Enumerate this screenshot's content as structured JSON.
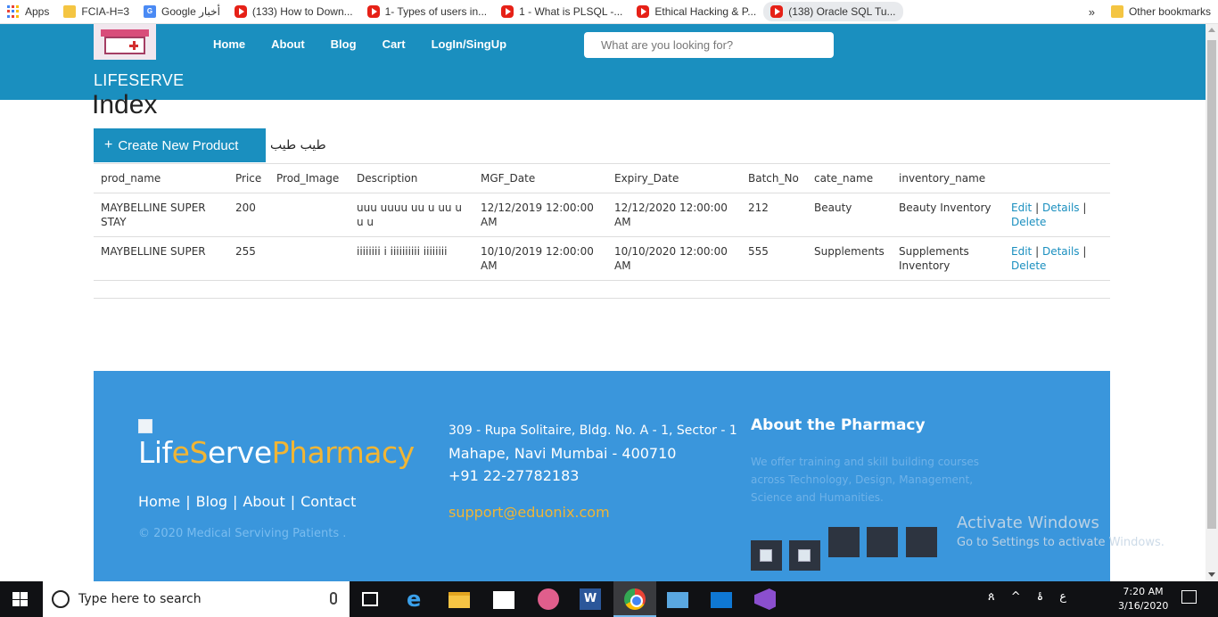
{
  "bookmarks": [
    {
      "label": "Apps",
      "icon": "apps-grid-icon"
    },
    {
      "label": "FCIA-H=3",
      "icon": "folder-icon"
    },
    {
      "label": "Google أخبار",
      "icon": "google-news-icon"
    },
    {
      "label": "(133) How to Down...",
      "icon": "youtube-icon"
    },
    {
      "label": "1- Types of users in...",
      "icon": "youtube-icon"
    },
    {
      "label": "1 - What is PLSQL -...",
      "icon": "youtube-icon"
    },
    {
      "label": "Ethical Hacking & P...",
      "icon": "youtube-icon"
    },
    {
      "label": "(138) Oracle SQL Tu...",
      "icon": "youtube-icon"
    }
  ],
  "bookmarks_more": "»",
  "bookmarks_other": "Other bookmarks",
  "header": {
    "brand": "LIFESERVE",
    "nav": [
      "Home",
      "About",
      "Blog",
      "Cart",
      "LogIn/SingUp"
    ],
    "search_placeholder": "What are you looking for?"
  },
  "page": {
    "heading": "Index",
    "create_label": "Create New Product",
    "create_icon": "+",
    "arabic_text": "طيب طيب"
  },
  "table": {
    "columns": [
      "prod_name",
      "Price",
      "Prod_Image",
      "Description",
      "MGF_Date",
      "Expiry_Date",
      "Batch_No",
      "cate_name",
      "inventory_name",
      ""
    ],
    "rows": [
      {
        "prod_name": "MAYBELLINE SUPER STAY",
        "price": "200",
        "prod_image": "",
        "description": "uuu uuuu uu u uu u u u",
        "mgf_date": "12/12/2019 12:00:00 AM",
        "expiry_date": "12/12/2020 12:00:00 AM",
        "batch_no": "212",
        "cate_name": "Beauty",
        "inventory_name": "Beauty Inventory",
        "edit": "Edit",
        "details": "Details",
        "delete": "Delete"
      },
      {
        "prod_name": "MAYBELLINE SUPER",
        "price": "255",
        "prod_image": "",
        "description": "iiiiiiii i iiiiiiiiii iiiiiiii",
        "mgf_date": "10/10/2019 12:00:00 AM",
        "expiry_date": "10/10/2020 12:00:00 AM",
        "batch_no": "555",
        "cate_name": "Supplements",
        "inventory_name": "Supplements Inventory",
        "edit": "Edit",
        "details": "Details",
        "delete": "Delete"
      }
    ],
    "link_separator": "|"
  },
  "footer": {
    "brand_parts": [
      "Lif",
      "e",
      "S",
      "erve",
      "Pharmacy"
    ],
    "links": [
      "Home",
      "Blog",
      "About",
      "Contact"
    ],
    "links_separator": "|",
    "copyright": "© 2020 Medical Serviving Patients .",
    "address_line1": "309 - Rupa Solitaire, Bldg. No. A - 1, Sector - 1",
    "address_line2": "Mahape, Navi Mumbai - 400710",
    "phone": "+91 22-27782183",
    "email": "support@eduonix.com",
    "about_heading": "About the Pharmacy",
    "about_text": "We offer training and skill building courses across Technology, Design, Management, Science and Humanities."
  },
  "watermark": {
    "title": "Activate Windows",
    "subtitle": "Go to Settings to activate Windows."
  },
  "taskbar": {
    "search_placeholder": "Type here to search",
    "tray_symbols": [
      "ጰ",
      "^",
      "ۂ",
      "ع"
    ],
    "time": "7:20 AM",
    "date": "3/16/2020"
  },
  "colors": {
    "header_bg": "#1a8fbf",
    "footer_bg": "#3a96dc",
    "accent_gold": "#f1b534",
    "link": "#1a8fbf"
  }
}
